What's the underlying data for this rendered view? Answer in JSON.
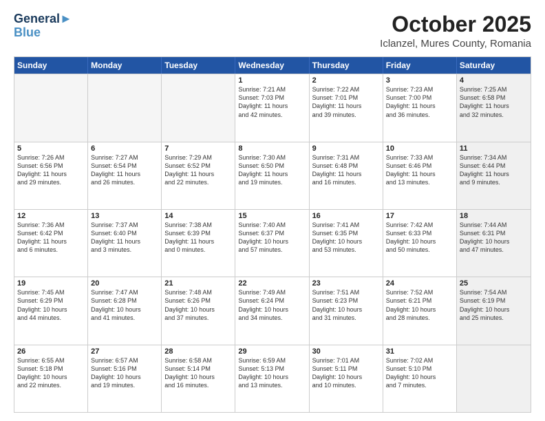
{
  "header": {
    "logo_line1": "General",
    "logo_line2": "Blue",
    "main_title": "October 2025",
    "subtitle": "Iclanzel, Mures County, Romania"
  },
  "weekdays": [
    "Sunday",
    "Monday",
    "Tuesday",
    "Wednesday",
    "Thursday",
    "Friday",
    "Saturday"
  ],
  "rows": [
    [
      {
        "day": "",
        "text": "",
        "empty": true
      },
      {
        "day": "",
        "text": "",
        "empty": true
      },
      {
        "day": "",
        "text": "",
        "empty": true
      },
      {
        "day": "1",
        "text": "Sunrise: 7:21 AM\nSunset: 7:03 PM\nDaylight: 11 hours\nand 42 minutes."
      },
      {
        "day": "2",
        "text": "Sunrise: 7:22 AM\nSunset: 7:01 PM\nDaylight: 11 hours\nand 39 minutes."
      },
      {
        "day": "3",
        "text": "Sunrise: 7:23 AM\nSunset: 7:00 PM\nDaylight: 11 hours\nand 36 minutes."
      },
      {
        "day": "4",
        "text": "Sunrise: 7:25 AM\nSunset: 6:58 PM\nDaylight: 11 hours\nand 32 minutes.",
        "shaded": true
      }
    ],
    [
      {
        "day": "5",
        "text": "Sunrise: 7:26 AM\nSunset: 6:56 PM\nDaylight: 11 hours\nand 29 minutes."
      },
      {
        "day": "6",
        "text": "Sunrise: 7:27 AM\nSunset: 6:54 PM\nDaylight: 11 hours\nand 26 minutes."
      },
      {
        "day": "7",
        "text": "Sunrise: 7:29 AM\nSunset: 6:52 PM\nDaylight: 11 hours\nand 22 minutes."
      },
      {
        "day": "8",
        "text": "Sunrise: 7:30 AM\nSunset: 6:50 PM\nDaylight: 11 hours\nand 19 minutes."
      },
      {
        "day": "9",
        "text": "Sunrise: 7:31 AM\nSunset: 6:48 PM\nDaylight: 11 hours\nand 16 minutes."
      },
      {
        "day": "10",
        "text": "Sunrise: 7:33 AM\nSunset: 6:46 PM\nDaylight: 11 hours\nand 13 minutes."
      },
      {
        "day": "11",
        "text": "Sunrise: 7:34 AM\nSunset: 6:44 PM\nDaylight: 11 hours\nand 9 minutes.",
        "shaded": true
      }
    ],
    [
      {
        "day": "12",
        "text": "Sunrise: 7:36 AM\nSunset: 6:42 PM\nDaylight: 11 hours\nand 6 minutes."
      },
      {
        "day": "13",
        "text": "Sunrise: 7:37 AM\nSunset: 6:40 PM\nDaylight: 11 hours\nand 3 minutes."
      },
      {
        "day": "14",
        "text": "Sunrise: 7:38 AM\nSunset: 6:39 PM\nDaylight: 11 hours\nand 0 minutes."
      },
      {
        "day": "15",
        "text": "Sunrise: 7:40 AM\nSunset: 6:37 PM\nDaylight: 10 hours\nand 57 minutes."
      },
      {
        "day": "16",
        "text": "Sunrise: 7:41 AM\nSunset: 6:35 PM\nDaylight: 10 hours\nand 53 minutes."
      },
      {
        "day": "17",
        "text": "Sunrise: 7:42 AM\nSunset: 6:33 PM\nDaylight: 10 hours\nand 50 minutes."
      },
      {
        "day": "18",
        "text": "Sunrise: 7:44 AM\nSunset: 6:31 PM\nDaylight: 10 hours\nand 47 minutes.",
        "shaded": true
      }
    ],
    [
      {
        "day": "19",
        "text": "Sunrise: 7:45 AM\nSunset: 6:29 PM\nDaylight: 10 hours\nand 44 minutes."
      },
      {
        "day": "20",
        "text": "Sunrise: 7:47 AM\nSunset: 6:28 PM\nDaylight: 10 hours\nand 41 minutes."
      },
      {
        "day": "21",
        "text": "Sunrise: 7:48 AM\nSunset: 6:26 PM\nDaylight: 10 hours\nand 37 minutes."
      },
      {
        "day": "22",
        "text": "Sunrise: 7:49 AM\nSunset: 6:24 PM\nDaylight: 10 hours\nand 34 minutes."
      },
      {
        "day": "23",
        "text": "Sunrise: 7:51 AM\nSunset: 6:23 PM\nDaylight: 10 hours\nand 31 minutes."
      },
      {
        "day": "24",
        "text": "Sunrise: 7:52 AM\nSunset: 6:21 PM\nDaylight: 10 hours\nand 28 minutes."
      },
      {
        "day": "25",
        "text": "Sunrise: 7:54 AM\nSunset: 6:19 PM\nDaylight: 10 hours\nand 25 minutes.",
        "shaded": true
      }
    ],
    [
      {
        "day": "26",
        "text": "Sunrise: 6:55 AM\nSunset: 5:18 PM\nDaylight: 10 hours\nand 22 minutes."
      },
      {
        "day": "27",
        "text": "Sunrise: 6:57 AM\nSunset: 5:16 PM\nDaylight: 10 hours\nand 19 minutes."
      },
      {
        "day": "28",
        "text": "Sunrise: 6:58 AM\nSunset: 5:14 PM\nDaylight: 10 hours\nand 16 minutes."
      },
      {
        "day": "29",
        "text": "Sunrise: 6:59 AM\nSunset: 5:13 PM\nDaylight: 10 hours\nand 13 minutes."
      },
      {
        "day": "30",
        "text": "Sunrise: 7:01 AM\nSunset: 5:11 PM\nDaylight: 10 hours\nand 10 minutes."
      },
      {
        "day": "31",
        "text": "Sunrise: 7:02 AM\nSunset: 5:10 PM\nDaylight: 10 hours\nand 7 minutes."
      },
      {
        "day": "",
        "text": "",
        "empty": true,
        "shaded": true
      }
    ]
  ]
}
